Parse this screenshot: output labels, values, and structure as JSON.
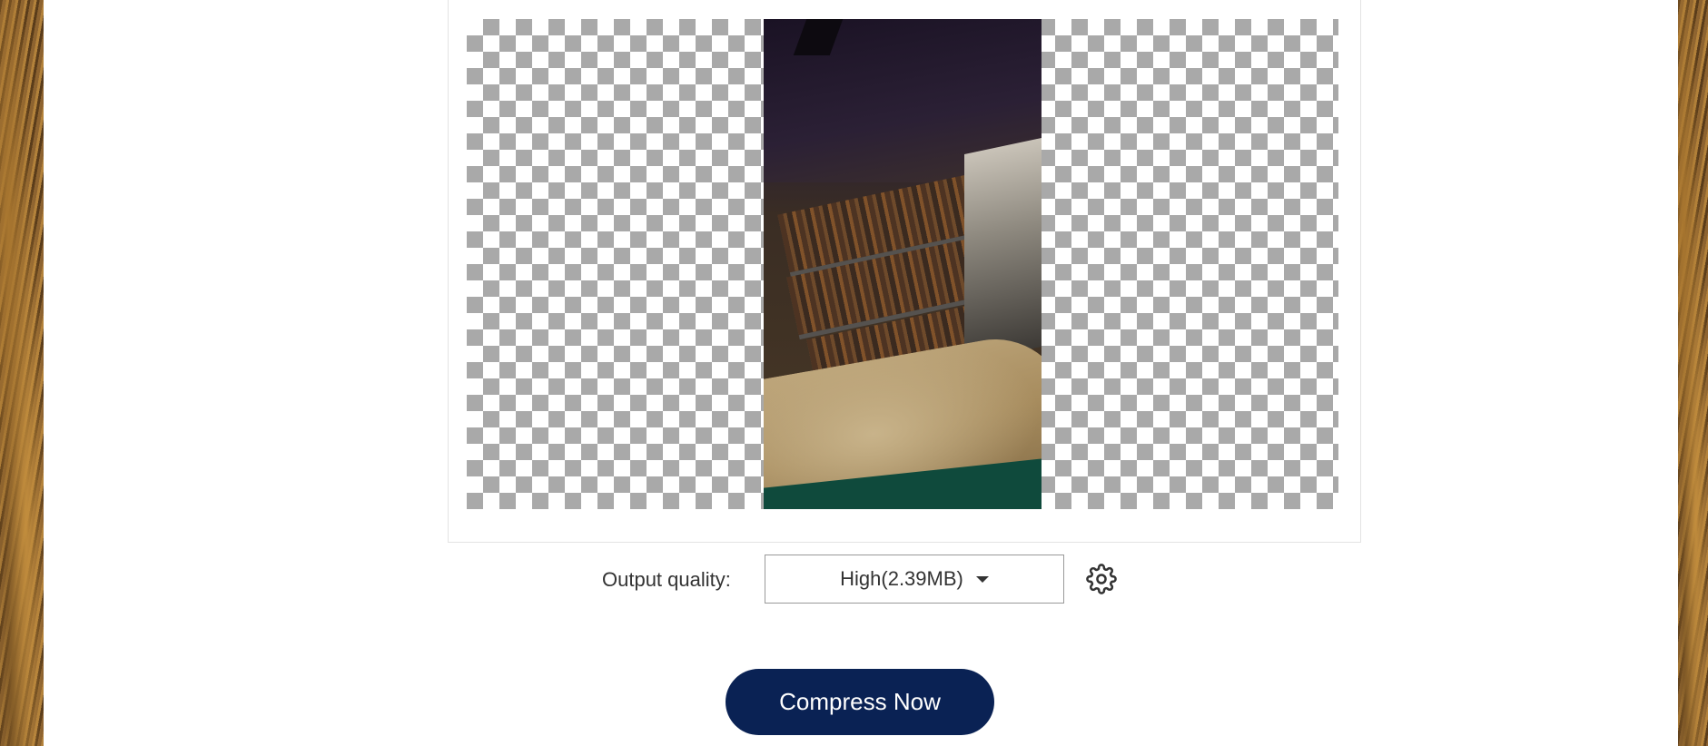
{
  "preview": {
    "icon": "video-thumbnail"
  },
  "output_quality": {
    "label": "Output quality:",
    "selected": "High(2.39MB)",
    "settings_icon": "gear-icon"
  },
  "actions": {
    "compress_label": "Compress Now"
  },
  "colors": {
    "button_bg": "#0a2254",
    "button_text": "#ffffff",
    "panel_bg": "#ffffff"
  }
}
